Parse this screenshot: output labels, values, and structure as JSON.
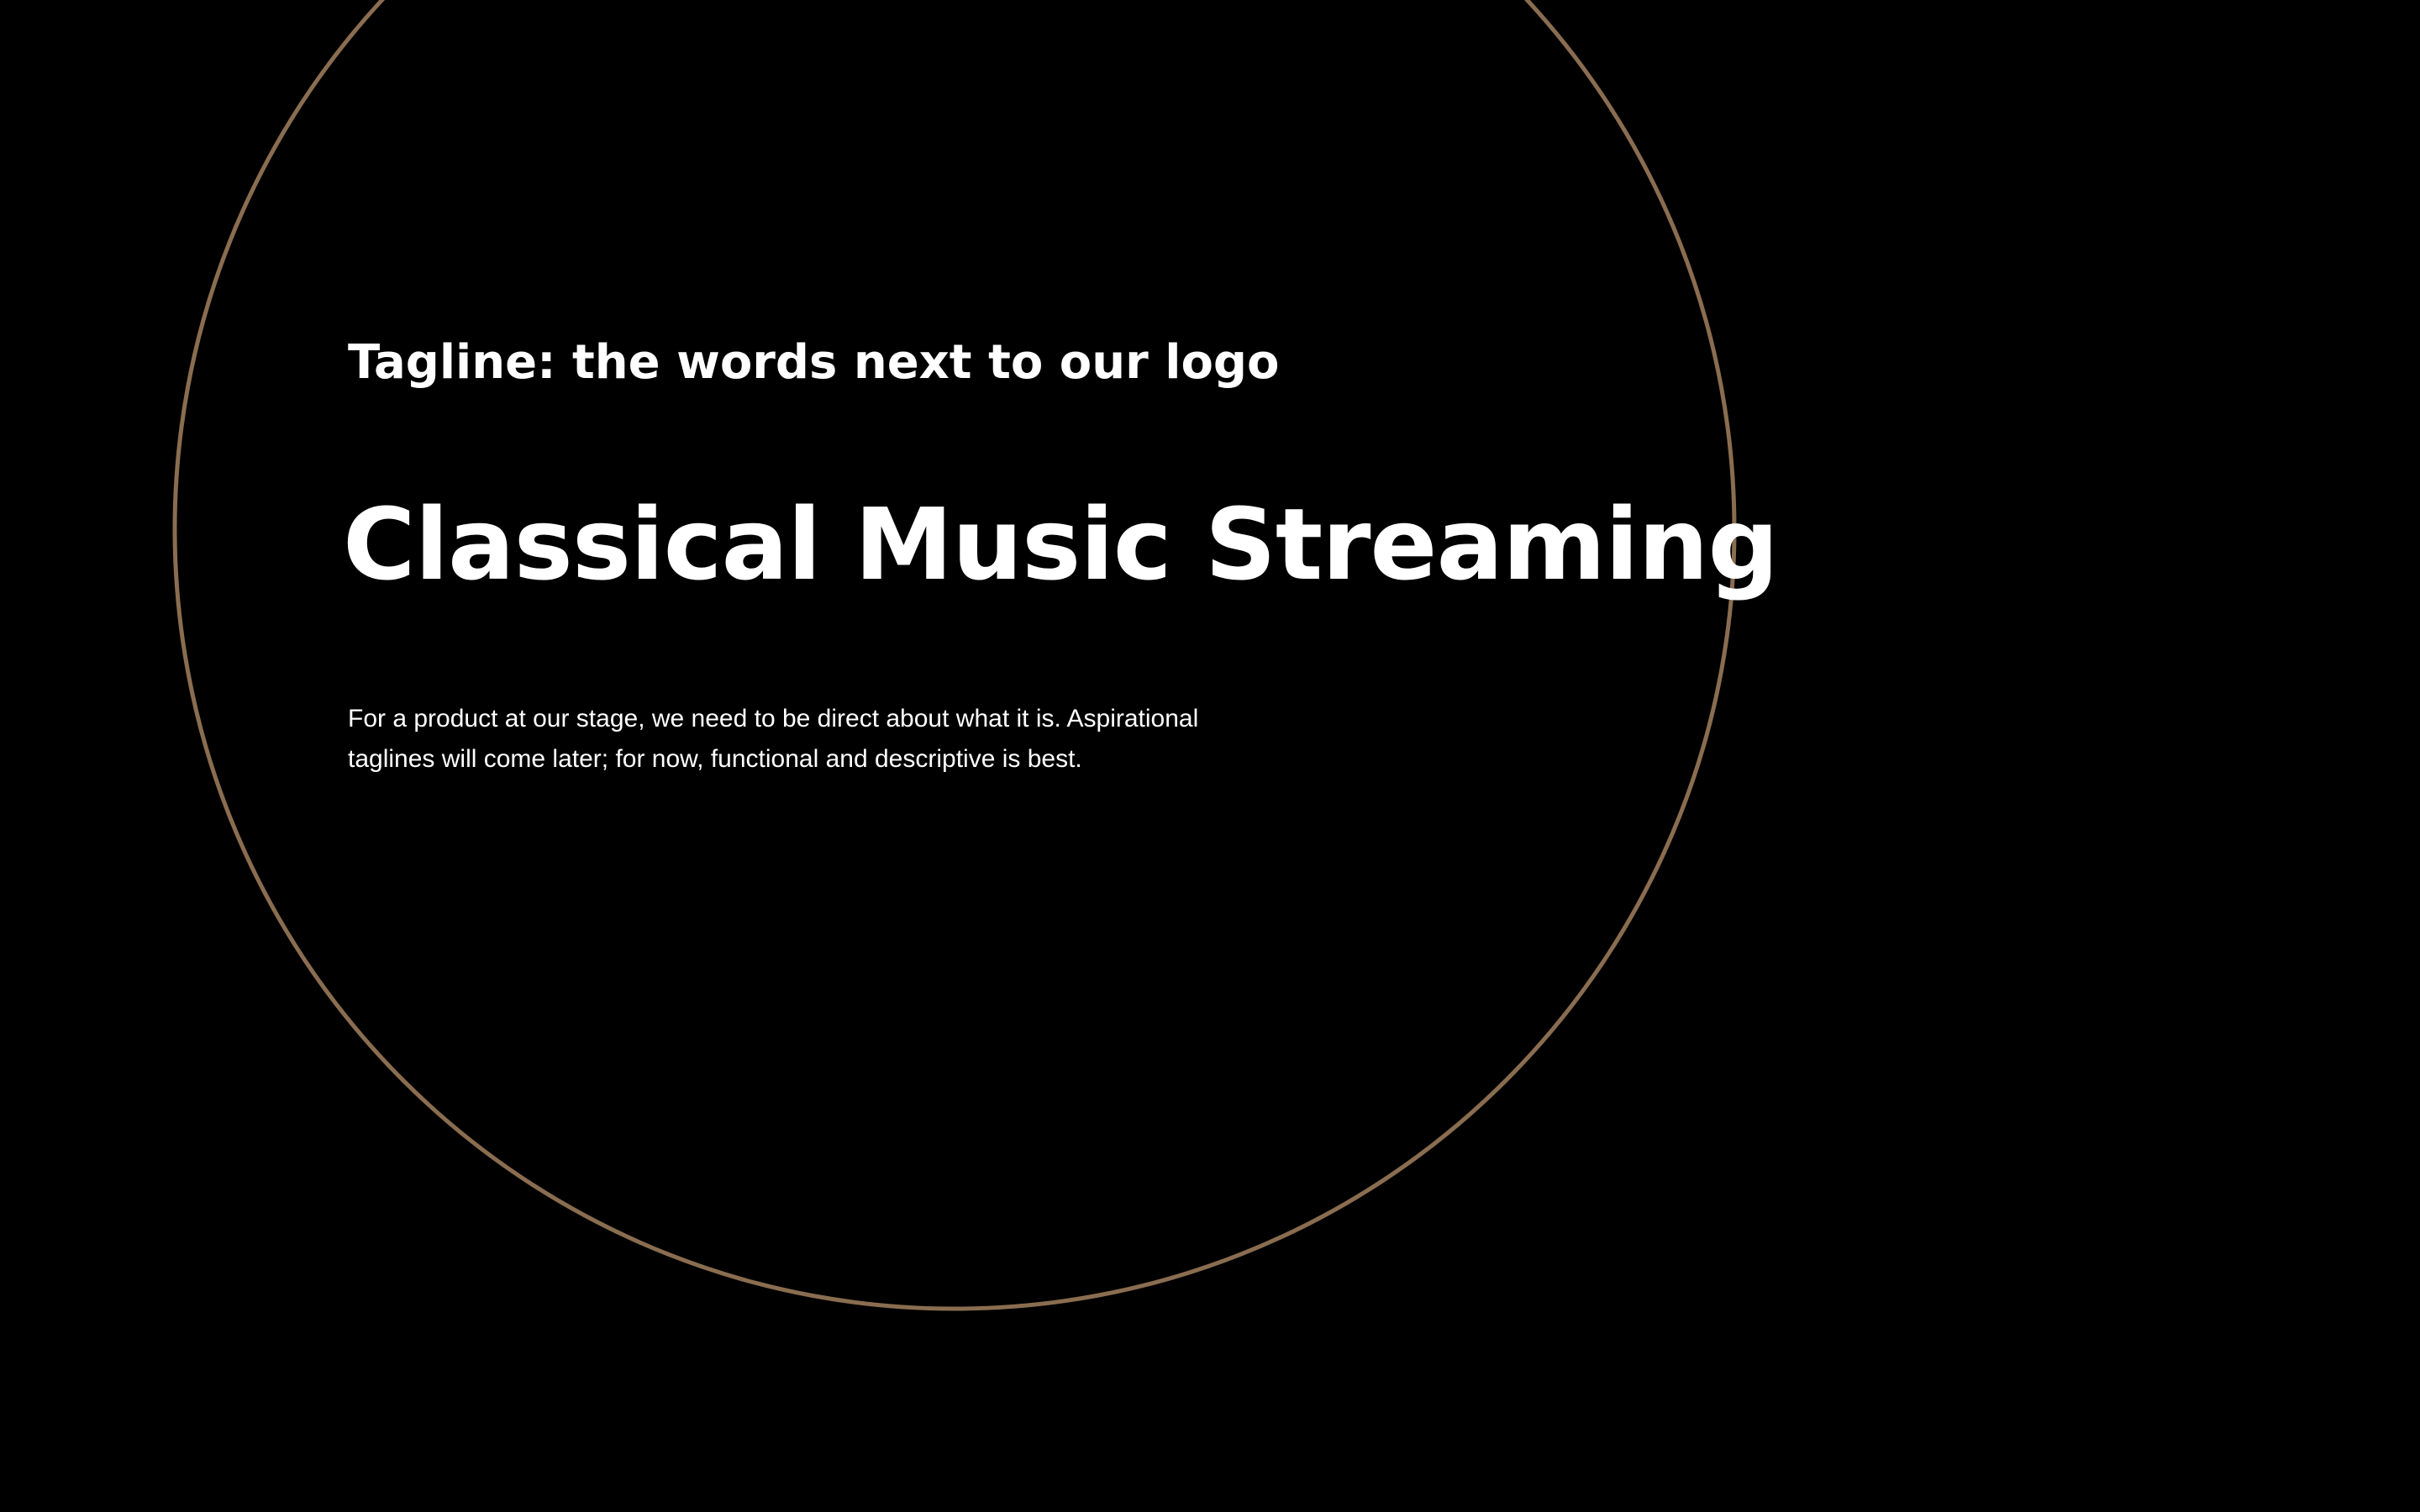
{
  "slide": {
    "tagline_label": "Tagline: the words next to our logo",
    "headline": "Classical Music Streaming",
    "description": "For a product at our stage, we need to be direct about what it is. Aspirational taglines will come later; for now, functional and descriptive is best."
  },
  "colors": {
    "background": "#000000",
    "text": "#ffffff",
    "circle_stroke": "#8a6d50"
  },
  "icons": [
    "circle-outline-decoration"
  ]
}
